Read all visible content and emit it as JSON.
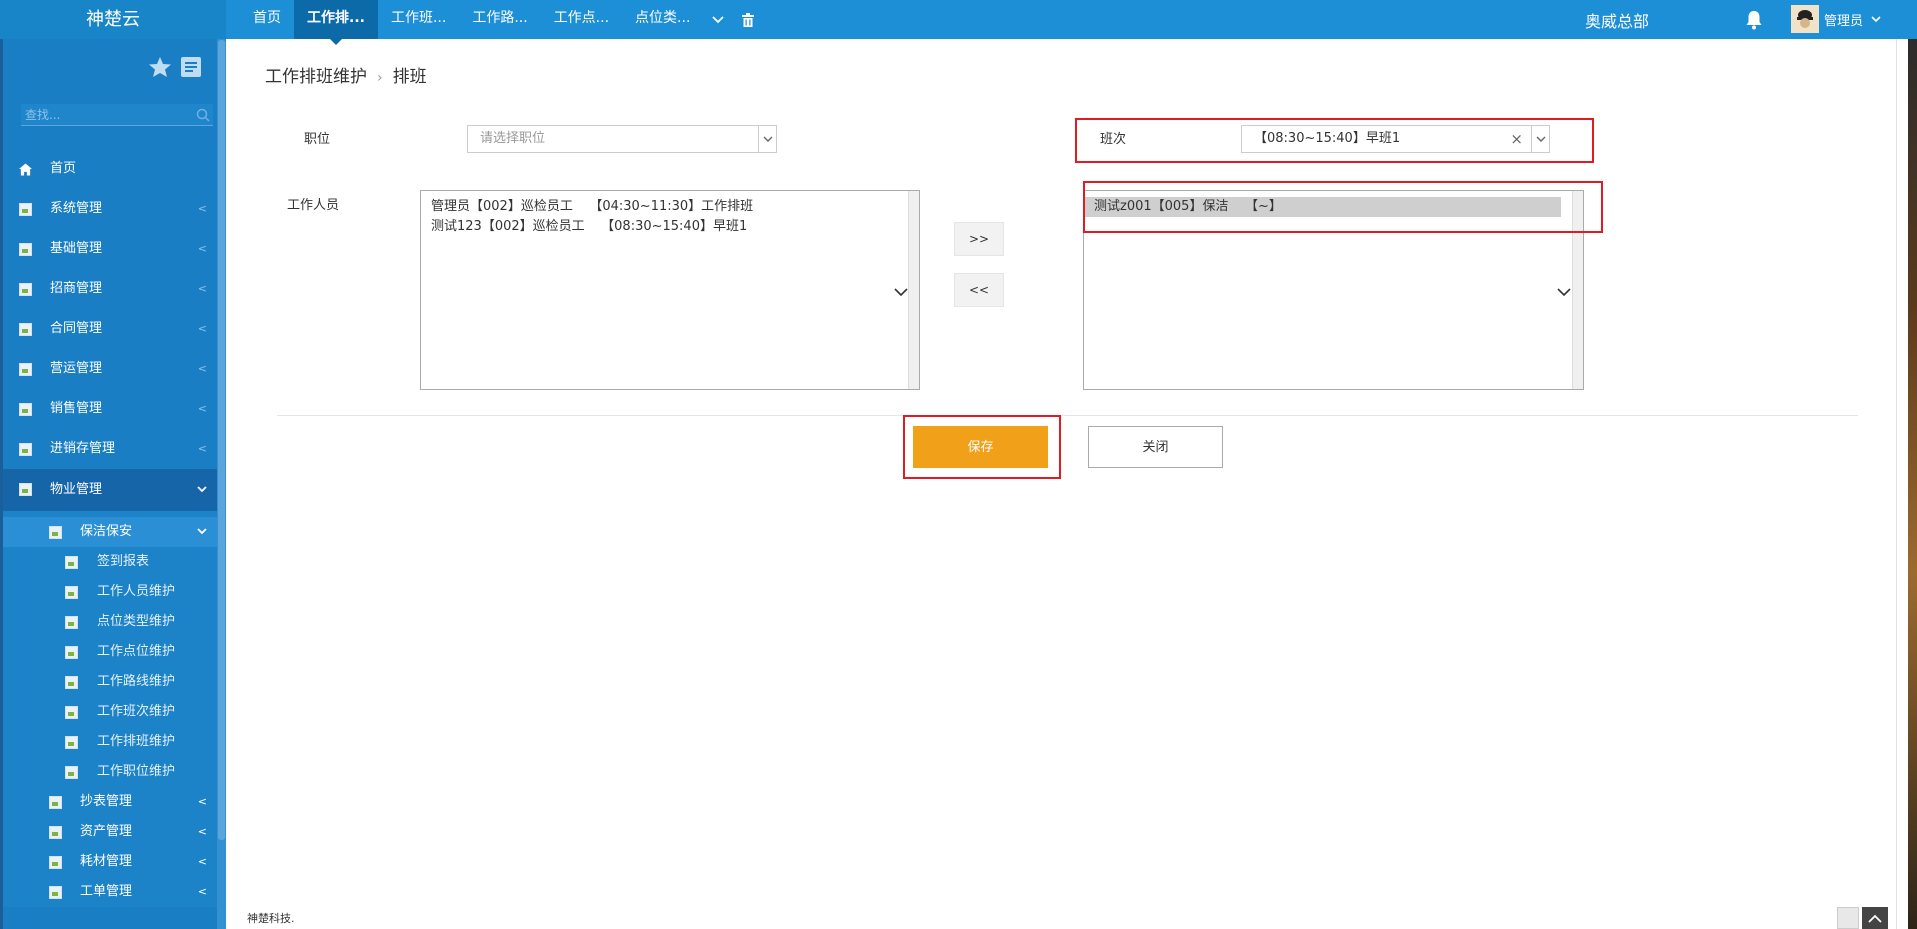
{
  "app": {
    "logo": "神楚云",
    "company": "奥威总部",
    "user": "管理员",
    "footer": "神楚科技."
  },
  "tabs": [
    {
      "label": "首页",
      "active": false
    },
    {
      "label": "工作排...",
      "active": true
    },
    {
      "label": "工作班...",
      "active": false
    },
    {
      "label": "工作路...",
      "active": false
    },
    {
      "label": "工作点...",
      "active": false
    },
    {
      "label": "点位类...",
      "active": false
    }
  ],
  "sidebar": {
    "search_placeholder": "查找...",
    "menu": [
      {
        "label": "首页",
        "icon": "home-icon"
      },
      {
        "label": "系统管理",
        "icon": "image-icon"
      },
      {
        "label": "基础管理",
        "icon": "image-icon"
      },
      {
        "label": "招商管理",
        "icon": "image-icon"
      },
      {
        "label": "合同管理",
        "icon": "image-icon"
      },
      {
        "label": "营运管理",
        "icon": "image-icon"
      },
      {
        "label": "销售管理",
        "icon": "image-icon"
      },
      {
        "label": "进销存管理",
        "icon": "image-icon"
      },
      {
        "label": "物业管理",
        "icon": "image-icon",
        "open": true
      }
    ],
    "submenu_open": {
      "label": "保洁保安",
      "items": [
        "签到报表",
        "工作人员维护",
        "点位类型维护",
        "工作点位维护",
        "工作路线维护",
        "工作班次维护",
        "工作排班维护",
        "工作职位维护"
      ]
    },
    "submenu_rest": [
      "抄表管理",
      "资产管理",
      "耗材管理",
      "工单管理"
    ]
  },
  "breadcrumb": {
    "parent": "工作排班维护",
    "current": "排班"
  },
  "form": {
    "position_label": "职位",
    "position_placeholder": "请选择职位",
    "shift_label": "班次",
    "shift_value": "【08:30~15:40】早班1",
    "staff_label": "工作人员"
  },
  "left_list": [
    "管理员【002】巡检员工    【04:30~11:30】工作排班",
    "测试123【002】巡检员工    【08:30~15:40】早班1"
  ],
  "right_list": [
    "测试z001【005】保洁    【~】"
  ],
  "buttons": {
    "move_right": ">>",
    "move_left": "<<",
    "save": "保存",
    "close": "关闭"
  },
  "colors": {
    "topbar": "#1d8fd6",
    "sidebar": "#1a7ec4",
    "save": "#f1a01a",
    "highlight": "#e01b24"
  }
}
